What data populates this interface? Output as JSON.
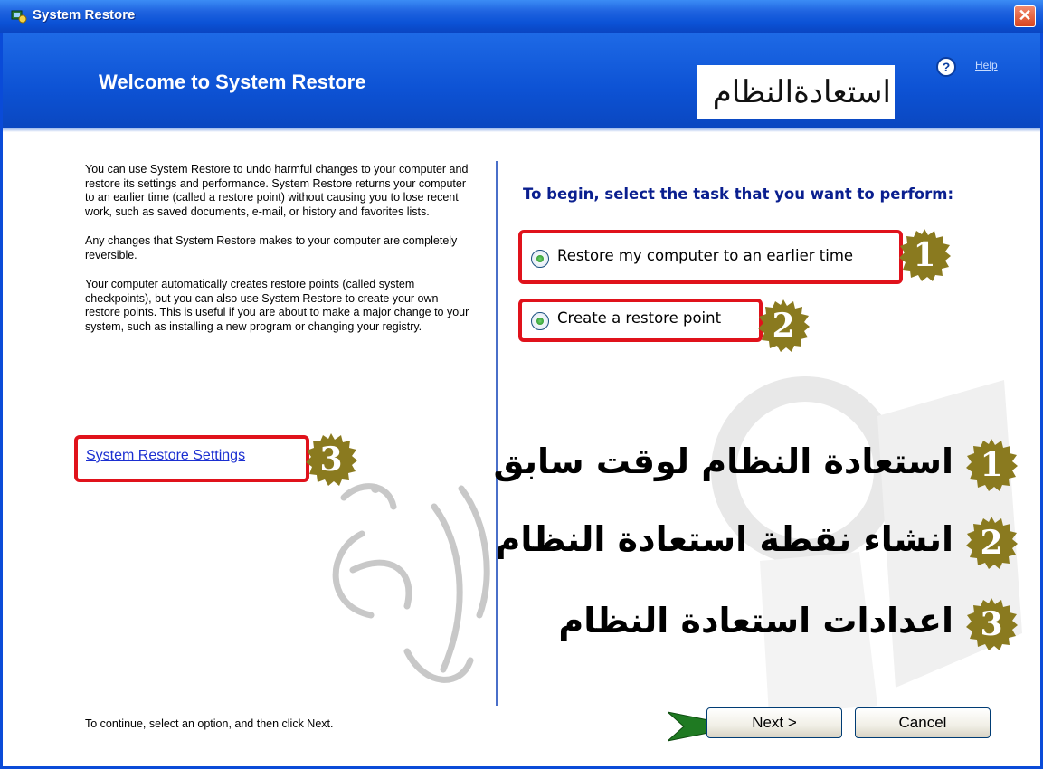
{
  "window": {
    "title": "System Restore",
    "close_symbol": "✕"
  },
  "header": {
    "title": "Welcome to System Restore",
    "help_symbol": "?",
    "help_label": "Help",
    "logo_text": "استعادةالنظام"
  },
  "left_panel": {
    "paragraphs": [
      "You can use System Restore to undo harmful changes to your computer and restore its settings and performance. System Restore returns your computer to an earlier time (called a restore point) without causing you to lose recent work, such as saved documents, e-mail, or history and favorites lists.",
      "Any changes that System Restore makes to your computer are completely reversible.",
      "Your computer automatically creates restore points (called system checkpoints), but you can also use System Restore to create your own restore points. This is useful if you are about to make a major change to your system, such as installing a new program or changing your registry."
    ],
    "settings_link": "System Restore Settings",
    "footer": "To continue, select an option, and then click Next."
  },
  "right_panel": {
    "prompt": "To begin, select the task that you want to perform:",
    "options": [
      {
        "label": "Restore my computer to an earlier time",
        "selected": true
      },
      {
        "label": "Create a restore point",
        "selected": true
      }
    ]
  },
  "annotations": {
    "badges": [
      "1",
      "2",
      "3"
    ],
    "legend": [
      {
        "number": "1",
        "text": "استعادة النظام لوقت سابق"
      },
      {
        "number": "2",
        "text": "انشاء نقطة استعادة النظام"
      },
      {
        "number": "3",
        "text": "اعدادات استعادة النظام"
      }
    ],
    "badge_color": "#8a7a1f"
  },
  "buttons": {
    "next": "Next >",
    "cancel": "Cancel"
  },
  "colors": {
    "titlebar": "#0b52d6",
    "header": "#0d52d4",
    "highlight_border": "#e0121b",
    "prompt_text": "#0a1f8f",
    "link": "#1b2fd1"
  }
}
